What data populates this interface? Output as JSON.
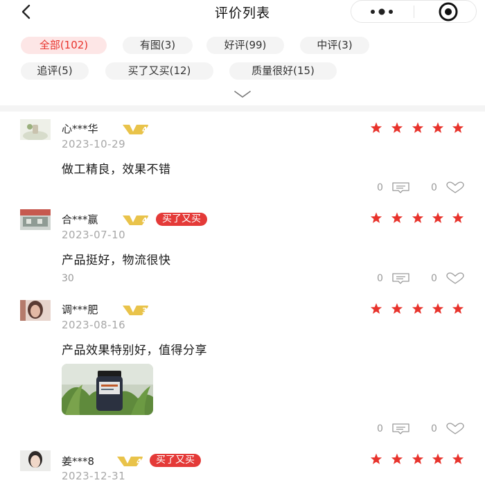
{
  "header": {
    "title": "评价列表",
    "back_icon": "chevron-left-icon",
    "more_icon": "more-dots-icon",
    "close_icon": "target-close-icon"
  },
  "filters": [
    {
      "label": "全部(102)",
      "active": true
    },
    {
      "label": "有图(3)",
      "active": false
    },
    {
      "label": "好评(99)",
      "active": false
    },
    {
      "label": "中评(3)",
      "active": false
    },
    {
      "label": "追评(5)",
      "active": false
    },
    {
      "label": "买了又买(12)",
      "active": false
    },
    {
      "label": "质量很好(15)",
      "active": false
    }
  ],
  "expand_icon": "chevron-down-icon",
  "colors": {
    "accent": "#e8332c",
    "tag_active_bg": "#fde6e6",
    "tag_bg": "#f4f4f4",
    "level_gold": "#e9c34a",
    "star": "#e8332c"
  },
  "reviews": [
    {
      "user": "心***华",
      "level": "4",
      "rebuy": "",
      "date": "2023-10-29",
      "rating": 5,
      "text": "做工精良，效果不错",
      "views": "",
      "comments": "0",
      "likes": "0"
    },
    {
      "user": "合***赢",
      "level": "4",
      "rebuy": "买了又买",
      "date": "2023-07-10",
      "rating": 5,
      "text": "产品挺好，物流很快",
      "views": "30",
      "comments": "0",
      "likes": "0"
    },
    {
      "user": "调***肥",
      "level": "3",
      "rebuy": "",
      "date": "2023-08-16",
      "rating": 5,
      "text": "产品效果特别好，值得分享",
      "views": "",
      "comments": "0",
      "likes": "0",
      "has_photo": true
    },
    {
      "user": "姜***8",
      "level": "4",
      "rebuy": "买了又买",
      "date": "2023-12-31",
      "rating": 5,
      "text": "",
      "views": "",
      "comments": "",
      "likes": ""
    }
  ]
}
